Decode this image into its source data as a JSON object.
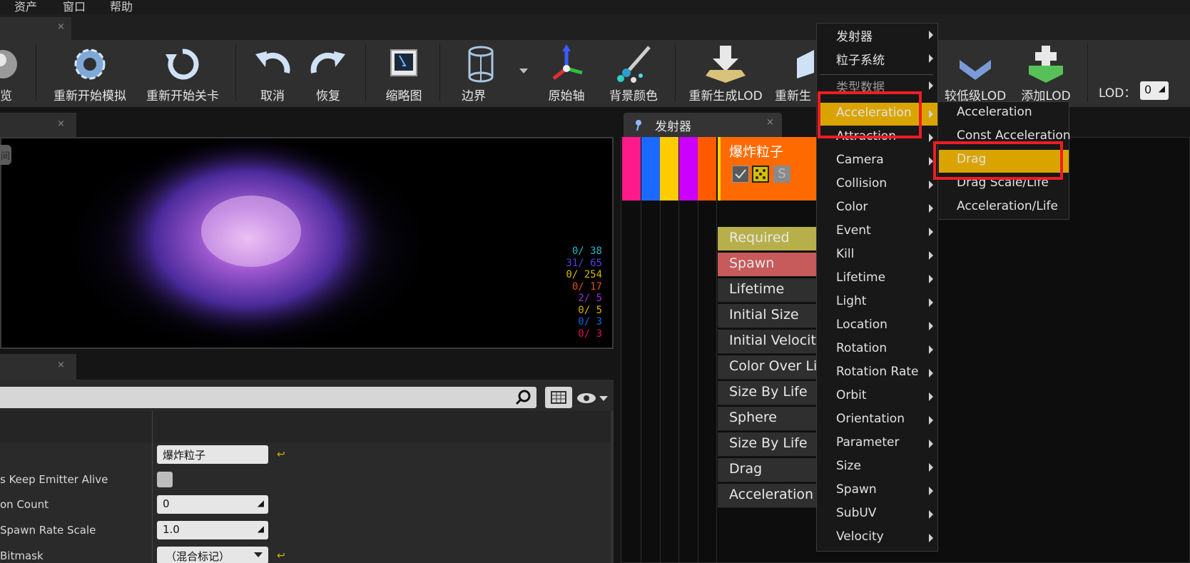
{
  "menubar": {
    "items": [
      "资产",
      "窗口",
      "帮助"
    ]
  },
  "tabs": {
    "close_glyph": "×"
  },
  "toolbar": {
    "buttons": [
      {
        "label": "览",
        "icon": "sphere-icon"
      },
      {
        "label": "重新开始模拟",
        "icon": "gear-restart-icon"
      },
      {
        "label": "重新开始关卡",
        "icon": "restart-level-icon"
      },
      {
        "label": "取消",
        "icon": "undo-icon"
      },
      {
        "label": "恢复",
        "icon": "redo-icon"
      },
      {
        "label": "缩略图",
        "icon": "thumbnail-icon"
      },
      {
        "label": "边界",
        "icon": "bounds-icon"
      },
      {
        "label": "原始轴",
        "icon": "origin-axis-icon"
      },
      {
        "label": "背景颜色",
        "icon": "background-color-icon"
      },
      {
        "label": "重新生成LOD",
        "icon": "regen-lod-icon"
      },
      {
        "label": "重新生",
        "icon": "regen-lod2-icon"
      },
      {
        "label": "较低级LOD",
        "icon": "lower-lod-icon"
      },
      {
        "label": "添加LOD",
        "icon": "add-lod-icon"
      }
    ],
    "lod_label": "LOD：",
    "lod_value": "0"
  },
  "viewport": {
    "tag": "间",
    "stats": [
      {
        "text": "0/  38",
        "color": "#1fb8c8"
      },
      {
        "text": "31/  65",
        "color": "#5a3fe0"
      },
      {
        "text": "0/ 254",
        "color": "#d4b800"
      },
      {
        "text": "0/  17",
        "color": "#e0501c"
      },
      {
        "text": "2/   5",
        "color": "#9b2bd8"
      },
      {
        "text": "0/   5",
        "color": "#e0b000"
      },
      {
        "text": "0/   3",
        "color": "#1e5fe0"
      },
      {
        "text": "0/   3",
        "color": "#e0104a"
      }
    ]
  },
  "details": {
    "properties": [
      {
        "label": "",
        "value": "爆炸粒子",
        "reset": "↩"
      },
      {
        "label": "s Keep Emitter Alive",
        "value": "",
        "checkbox": true
      },
      {
        "label": "on Count",
        "value": "0"
      },
      {
        "label": "Spawn Rate Scale",
        "value": "1.0"
      },
      {
        "label": "Bitmask",
        "value": "（混合标记）",
        "reset": "↩"
      }
    ]
  },
  "emitters": {
    "tab_label": "发射器",
    "emitter_name": "爆炸粒子",
    "stripe_colors": [
      "#ff1a8c",
      "#1a6aff",
      "#ffcc00",
      "#cc00ff",
      "#ff5a00"
    ],
    "modules": [
      {
        "label": "Required",
        "bg": "#b7b04a"
      },
      {
        "label": "Spawn",
        "bg": "#c75a5a"
      },
      {
        "label": "Lifetime",
        "bg": "#2f2f2f"
      },
      {
        "label": "Initial Size",
        "bg": "#2f2f2f"
      },
      {
        "label": "Initial Velocity",
        "bg": "#2f2f2f"
      },
      {
        "label": "Color Over Life",
        "bg": "#2f2f2f"
      },
      {
        "label": "Size By Life",
        "bg": "#2f2f2f"
      },
      {
        "label": "Sphere",
        "bg": "#2f2f2f"
      },
      {
        "label": "Size By Life",
        "bg": "#2f2f2f"
      },
      {
        "label": "Drag",
        "bg": "#2f2f2f"
      },
      {
        "label": "Acceleration",
        "bg": "#2f2f2f"
      }
    ]
  },
  "context_menu": {
    "items": [
      "发射器",
      "粒子系统",
      "类型数据",
      "Acceleration",
      "Attraction",
      "Camera",
      "Collision",
      "Color",
      "Event",
      "Kill",
      "Lifetime",
      "Light",
      "Location",
      "Rotation",
      "Rotation Rate",
      "Orbit",
      "Orientation",
      "Parameter",
      "Size",
      "Spawn",
      "SubUV",
      "Velocity"
    ],
    "highlighted": "Acceleration",
    "highlight_color": "#d9a400",
    "annotation_color": "#ee1c25"
  },
  "submenu": {
    "items": [
      "Acceleration",
      "Const Acceleration",
      "Drag",
      "Drag Scale/Life",
      "Acceleration/Life"
    ],
    "highlighted": "Drag"
  }
}
